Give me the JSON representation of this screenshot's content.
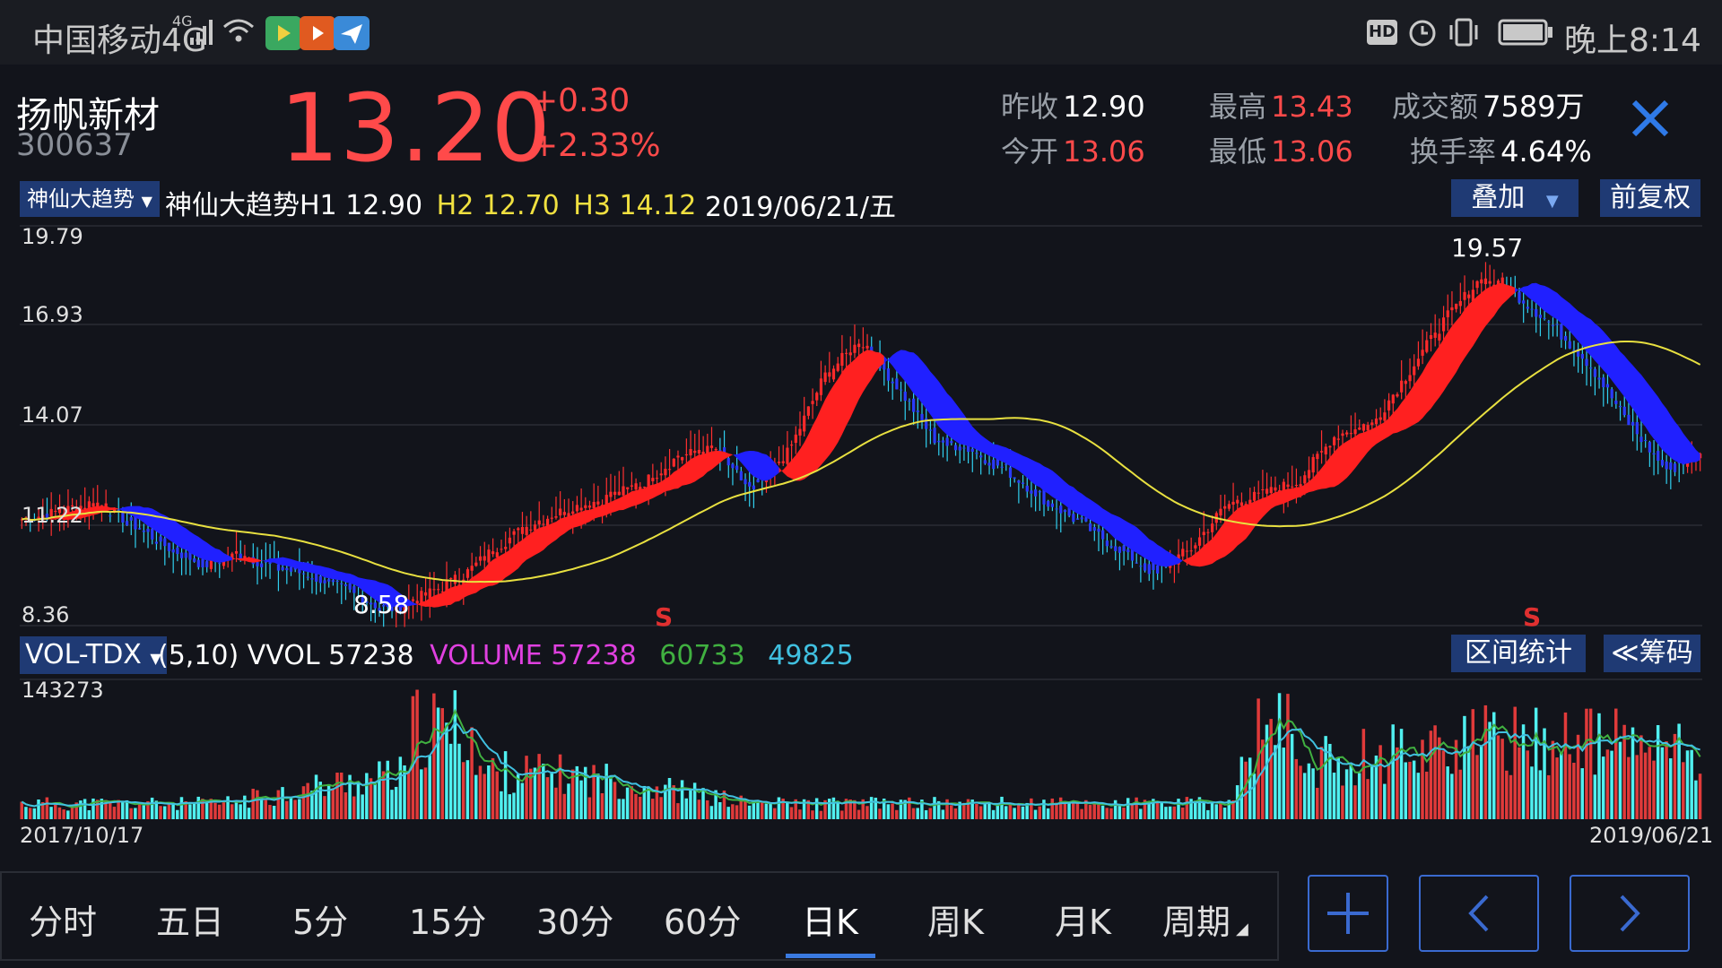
{
  "status_bar": {
    "carrier": "中国移动4G",
    "net_badge": "4G",
    "hd": "HD",
    "time": "晚上8:14"
  },
  "stock": {
    "name": "扬帆新材",
    "code": "300637",
    "price": "13.20",
    "change": "+0.30",
    "change_pct": "+2.33%",
    "prev_close_label": "昨收",
    "prev_close": "12.90",
    "open_label": "今开",
    "open": "13.06",
    "high_label": "最高",
    "high": "13.43",
    "low_label": "最低",
    "low": "13.06",
    "turnover_label": "成交额",
    "turnover": "7589万",
    "turnover_rate_label": "换手率",
    "turnover_rate": "4.64%"
  },
  "indicator": {
    "selector": "神仙大趋势",
    "h1_label": "神仙大趋势H1",
    "h1": "12.90",
    "h2_label": "H2",
    "h2": "12.70",
    "h3_label": "H3",
    "h3": "14.12",
    "date": "2019/06/21/五",
    "overlay_btn": "叠加",
    "adjust_btn": "前复权"
  },
  "volume_indicator": {
    "selector": "VOL-TDX",
    "params": "(5,10) VVOL",
    "vvol": "57238",
    "volume_label": "VOLUME",
    "volume": "57238",
    "ma5": "60733",
    "ma10": "49825",
    "range_btn": "区间统计",
    "chips_btn": "≪筹码"
  },
  "chart_data": [
    {
      "type": "candlestick",
      "y_ticks": [
        "19.79",
        "16.93",
        "14.07",
        "11.22",
        "8.36"
      ],
      "ylim": [
        8.36,
        19.79
      ],
      "max_label": "19.57",
      "min_label": "8.58",
      "signal_markers": [
        {
          "label": "S",
          "date": "2018-06"
        },
        {
          "label": "S",
          "date": "2019-04"
        }
      ],
      "approx_close_path": [
        11.4,
        11.6,
        11.9,
        11.3,
        10.6,
        10.1,
        10.4,
        10.0,
        9.8,
        9.3,
        8.8,
        9.2,
        9.7,
        10.6,
        11.3,
        11.7,
        12.0,
        12.4,
        13.2,
        13.4,
        12.2,
        13.3,
        15.5,
        16.5,
        15.2,
        13.7,
        13.4,
        12.8,
        12.0,
        11.3,
        10.6,
        9.9,
        10.5,
        11.8,
        12.1,
        12.5,
        13.8,
        14.1,
        15.6,
        17.1,
        18.3,
        17.8,
        16.9,
        15.8,
        14.2,
        12.9,
        13.2
      ],
      "trend_line_color": "#e8e040",
      "up_color": "#ff2a2a",
      "down_color": "#2a3aff"
    },
    {
      "type": "bar",
      "title": "VOL-TDX",
      "y_max_label": "143273",
      "x_start": "2017/10/17",
      "x_end": "2019/06/21",
      "up_color": "#e03a3a",
      "down_color": "#50f0f0"
    }
  ],
  "tabs": [
    "分时",
    "五日",
    "5分",
    "15分",
    "30分",
    "60分",
    "日K",
    "周K",
    "月K",
    "周期"
  ],
  "active_tab": "日K"
}
